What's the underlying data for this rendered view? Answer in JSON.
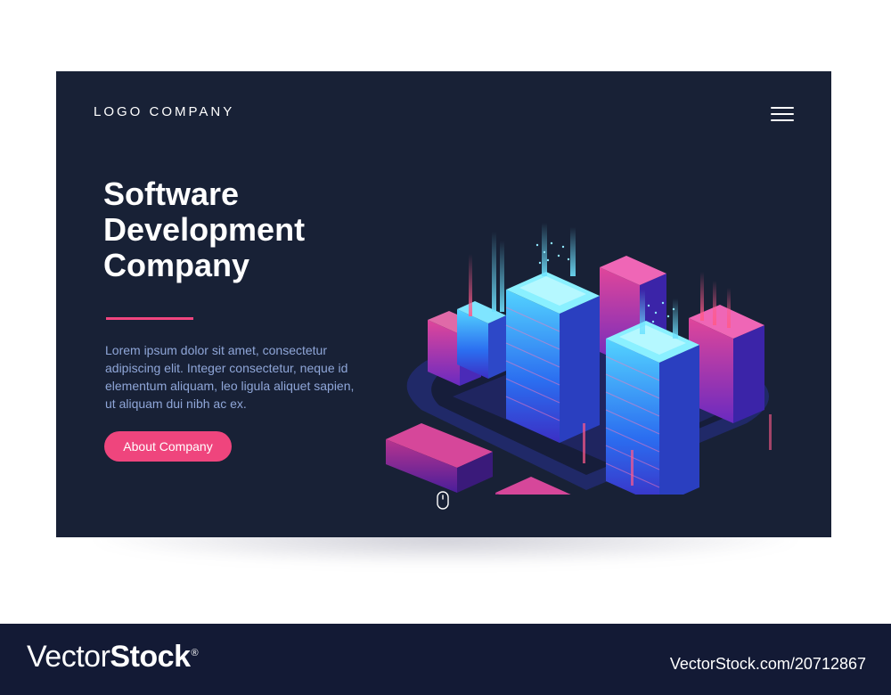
{
  "header": {
    "logo_text": "LOGO COMPANY",
    "menu_icon": "hamburger-menu-icon"
  },
  "hero": {
    "title_lines": [
      "Software",
      "Development",
      "Company"
    ],
    "description": "Lorem ipsum dolor sit amet, consectetur adipiscing elit. Integer consectetur, neque id elementum aliquam, leo ligula aliquet sapien, ut aliquam dui nibh ac ex.",
    "cta_label": "About Company",
    "scroll_icon": "mouse-scroll-icon",
    "illustration": "isometric-city-icon"
  },
  "watermark": {
    "brand_regular": "Vector",
    "brand_bold": "Stock",
    "registered": "®",
    "url": "VectorStock.com/20712867"
  },
  "colors": {
    "card_bg": "#182136",
    "accent": "#ef457d",
    "body_text": "#8fa6d8",
    "footer_bg": "#131a35"
  }
}
